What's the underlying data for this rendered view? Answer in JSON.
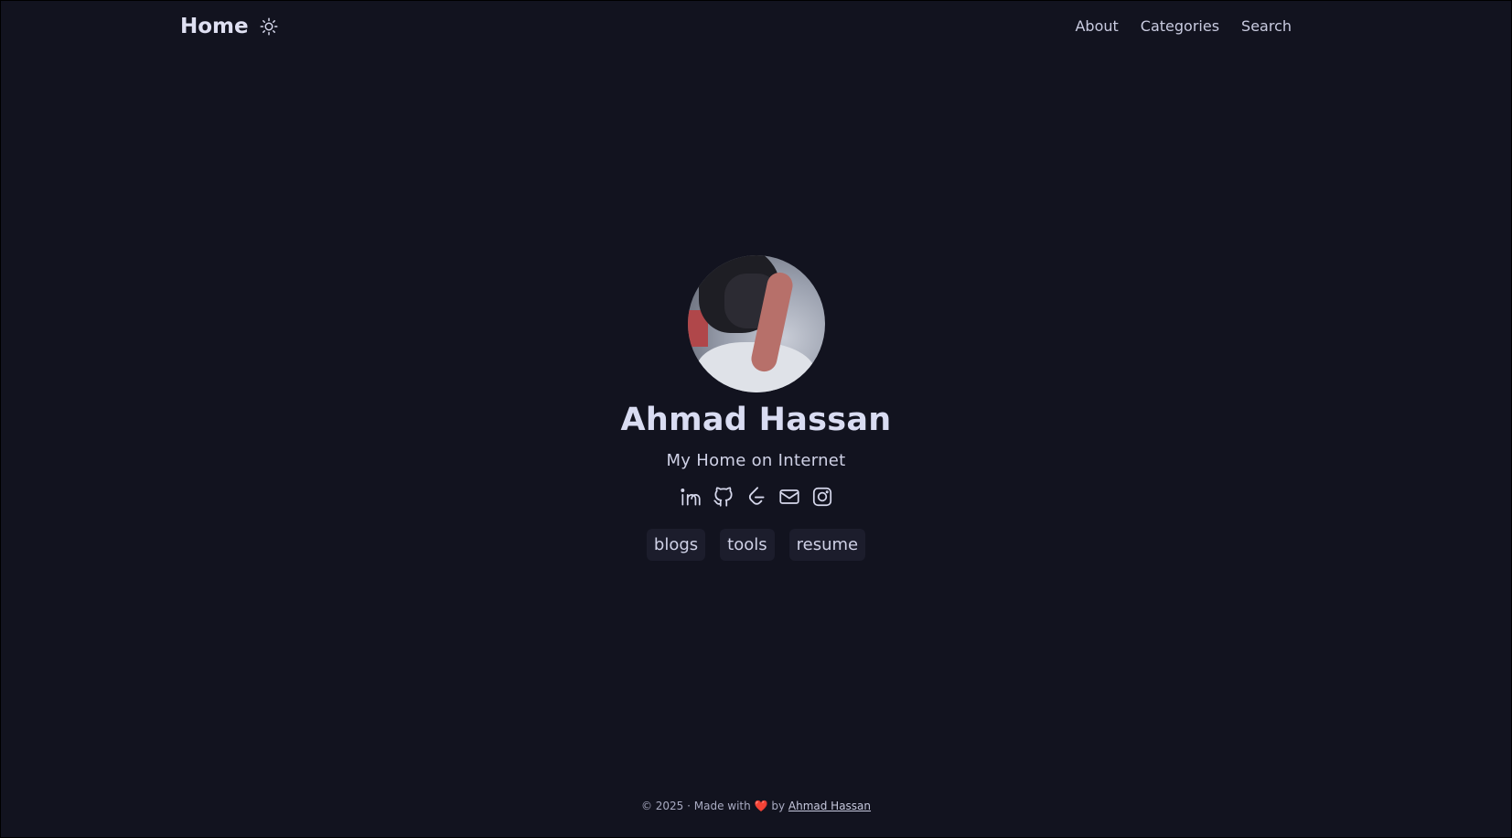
{
  "header": {
    "logo": "Home",
    "theme_toggle_icon": "sun-icon",
    "nav": [
      {
        "label": "About"
      },
      {
        "label": "Categories"
      },
      {
        "label": "Search"
      }
    ]
  },
  "profile": {
    "name": "Ahmad Hassan",
    "tagline": "My Home on Internet",
    "socials": [
      {
        "icon": "linkedin-icon"
      },
      {
        "icon": "github-icon"
      },
      {
        "icon": "leetcode-icon"
      },
      {
        "icon": "email-icon"
      },
      {
        "icon": "instagram-icon"
      }
    ],
    "buttons": [
      {
        "label": "blogs"
      },
      {
        "label": "tools"
      },
      {
        "label": "resume"
      }
    ]
  },
  "footer": {
    "prefix": "© 2025 · Made with",
    "heart": "❤️",
    "by": "by",
    "author": "Ahmad Hassan"
  },
  "colors": {
    "background": "#12131f",
    "text": "#d6d8ec",
    "pill_bg": "#1c1d2c"
  }
}
